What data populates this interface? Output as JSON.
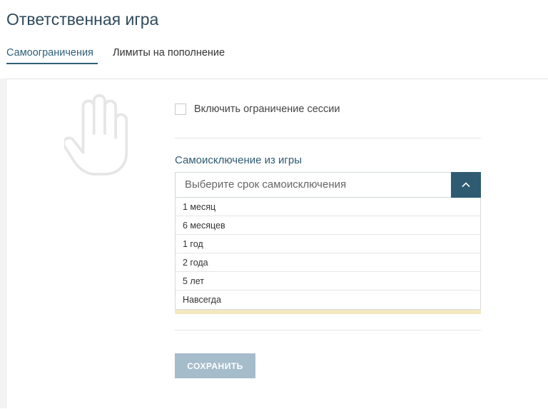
{
  "page": {
    "title": "Ответственная игра"
  },
  "tabs": [
    {
      "label": "Самоограничения",
      "active": true
    },
    {
      "label": "Лимиты на пополнение",
      "active": false
    }
  ],
  "session_limit": {
    "checkbox_label": "Включить ограничение сессии",
    "checked": false
  },
  "self_exclusion": {
    "label": "Самоисключение из игры",
    "placeholder": "Выберите срок самоисключения",
    "toggle_icon": "chevron-up-icon",
    "options": [
      "1 месяц",
      "6 месяцев",
      "1 год",
      "2 года",
      "5 лет",
      "Навсегда"
    ]
  },
  "actions": {
    "save_label": "СОХРАНИТЬ"
  },
  "icons": {
    "illustration": "hand-stop-icon"
  },
  "colors": {
    "accent": "#2f5b72",
    "title": "#2f4a5c",
    "button_disabled": "#a5bccb",
    "highlight": "#f3e8bf"
  }
}
